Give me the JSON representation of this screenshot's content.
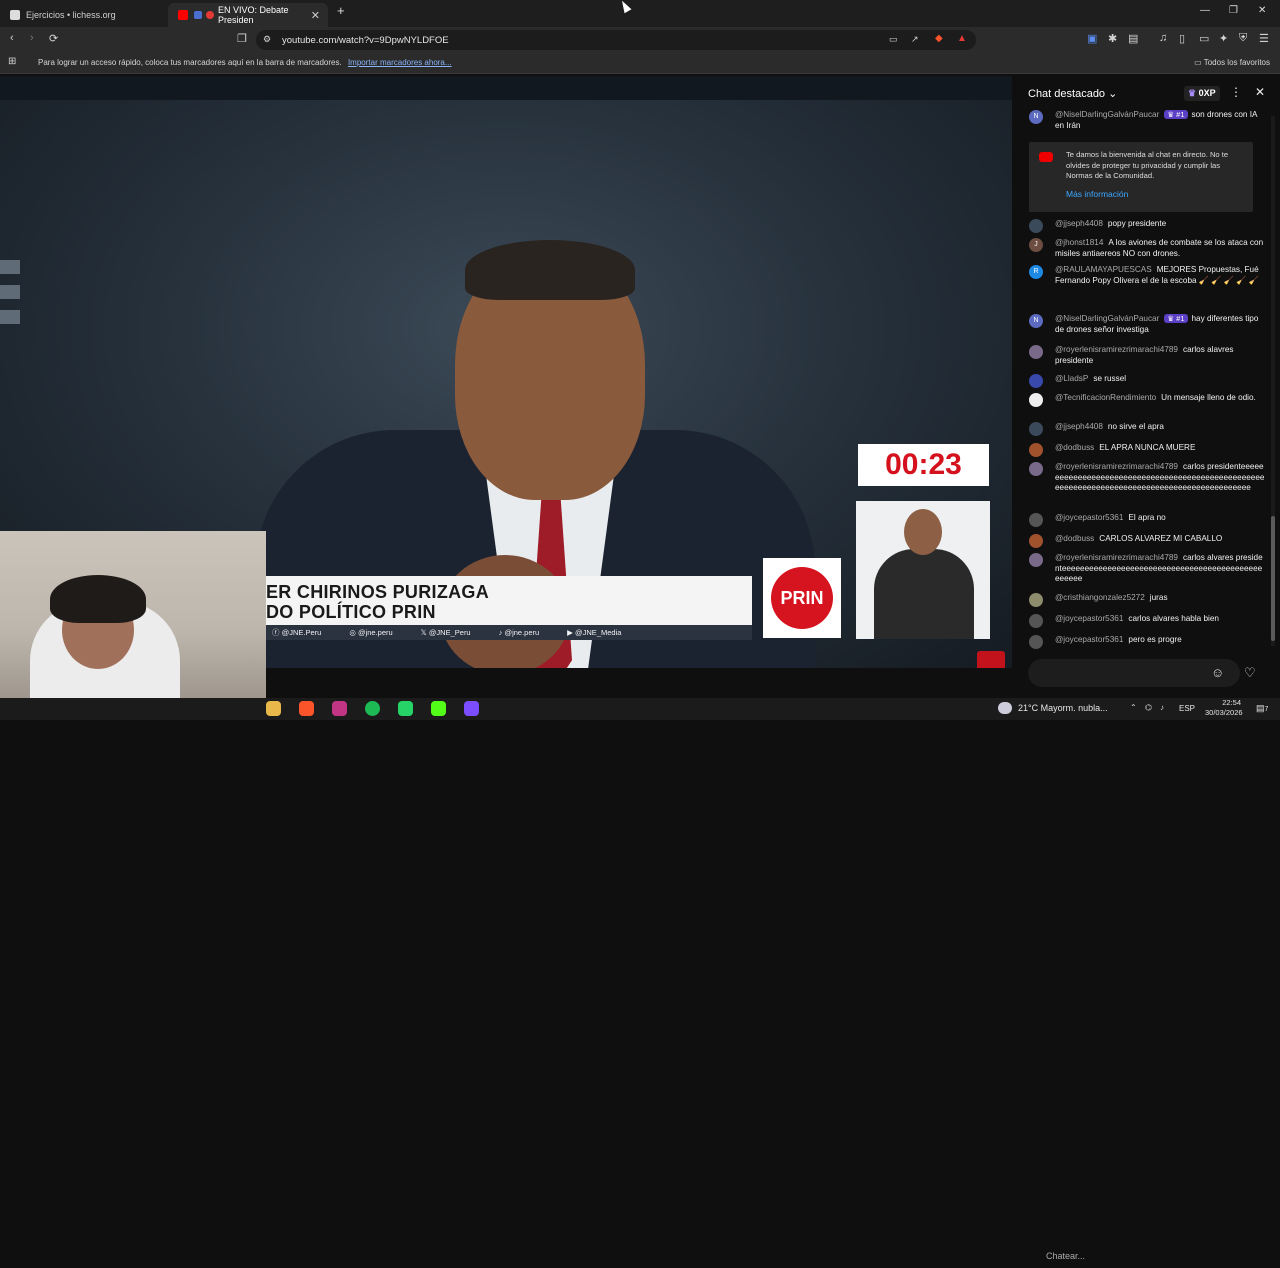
{
  "browser": {
    "tabs": [
      {
        "title": "Ejercicios • lichess.org",
        "active": false
      },
      {
        "title": "EN VIVO: Debate Presiden",
        "active": true
      }
    ],
    "url": "youtube.com/watch?v=9DpwNYLDFOE",
    "bookmarks_hint": "Para lograr un acceso rápido, coloca tus marcadores aquí en la barra de marcadores.",
    "bookmarks_import": "Importar marcadores ahora...",
    "all_favorites": "Todos los favoritos"
  },
  "video": {
    "lower_third_line1": "ER CHIRINOS PURIZAGA",
    "lower_third_line2": "DO POLÍTICO PRIN",
    "socials": [
      "@JNE.Peru",
      "@jne.peru",
      "@JNE_Peru",
      "@jne.peru",
      "@JNE_Media"
    ],
    "party_logo": "PRIN",
    "timer": "00:23"
  },
  "chat": {
    "title": "Chat destacado",
    "xp": "0XP",
    "welcome": "Te damos la bienvenida al chat en directo. No te olvides de proteger tu privacidad y cumplir las Normas de la Comunidad.",
    "more_info": "Más información",
    "input_placeholder": "Chatear...",
    "messages": [
      {
        "author": "@NiselDarlingGalvánPaucar",
        "badge": "#1",
        "text": "son drones con IA en Irán",
        "avatar": "N",
        "color": "#5c6bc0"
      },
      {
        "author": "@jjseph4408",
        "badge": "",
        "text": "popy presidente",
        "avatar": "",
        "color": "#3a4a5a"
      },
      {
        "author": "@jhonst1814",
        "badge": "",
        "text": "A los aviones de combate se los ataca con misiles antiaereos NO con drones.",
        "avatar": "J",
        "color": "#6d4c41"
      },
      {
        "author": "@RAULAMAYAPUESCAS",
        "badge": "",
        "text": "MEJORES Propuestas, Fué Fernando Popy Olivera el de la escoba 🧹 🧹 🧹 🧹 🧹",
        "avatar": "R",
        "color": "#1e88e5"
      },
      {
        "author": "@NiselDarlingGalvánPaucar",
        "badge": "#1",
        "text": "hay diferentes tipo de drones señor investiga",
        "avatar": "N",
        "color": "#5c6bc0"
      },
      {
        "author": "@royerlenisramirezrimarachi4789",
        "badge": "",
        "text": "carlos alavres presidente",
        "avatar": "",
        "color": "#7a6a8a"
      },
      {
        "author": "@LladsP",
        "badge": "",
        "text": "se russel",
        "avatar": "",
        "color": "#3949ab"
      },
      {
        "author": "@TecnificacionRendimiento",
        "badge": "",
        "text": "Un mensaje lleno de odio.",
        "avatar": "",
        "color": "#eeeeee"
      },
      {
        "author": "@jjseph4408",
        "badge": "",
        "text": "no sirve el apra",
        "avatar": "",
        "color": "#3a4a5a"
      },
      {
        "author": "@dodbuss",
        "badge": "",
        "text": "EL APRA NUNCA MUERE",
        "avatar": "",
        "color": "#a0522d"
      },
      {
        "author": "@royerlenisramirezrimarachi4789",
        "badge": "",
        "text": "carlos presidenteeeeeeeeeeeeeeeeeeeeeeeeeeeeeeeeeeeeeeeeeeeeeeeeeeeeeeeeeeeeeeeeeeeeeeeeeeeeeeeeeeeeeeeeeeeeee",
        "avatar": "",
        "color": "#7a6a8a"
      },
      {
        "author": "@joycepastor5361",
        "badge": "",
        "text": "El apra no",
        "avatar": "",
        "color": "#555"
      },
      {
        "author": "@dodbuss",
        "badge": "",
        "text": "CARLOS ALVAREZ MI CABALLO",
        "avatar": "",
        "color": "#a0522d"
      },
      {
        "author": "@royerlenisramirezrimarachi4789",
        "badge": "",
        "text": "carlos alvares presidenteeeeeeeeeeeeeeeeeeeeeeeeeeeeeeeeeeeeeeeeeeeeeeeeee",
        "avatar": "",
        "color": "#7a6a8a"
      },
      {
        "author": "@cristhiangonzalez5272",
        "badge": "",
        "text": "juras",
        "avatar": "",
        "color": "#8d8d6d"
      },
      {
        "author": "@joycepastor5361",
        "badge": "",
        "text": "carlos alvares habla bien",
        "avatar": "",
        "color": "#555"
      },
      {
        "author": "@joycepastor5361",
        "badge": "",
        "text": "pero es progre",
        "avatar": "",
        "color": "#555"
      }
    ]
  },
  "taskbar": {
    "weather": "21°C  Mayorm. nubla...",
    "lang": "ESP",
    "time": "22:54",
    "date": "30/03/2026",
    "notif_count": "7"
  }
}
